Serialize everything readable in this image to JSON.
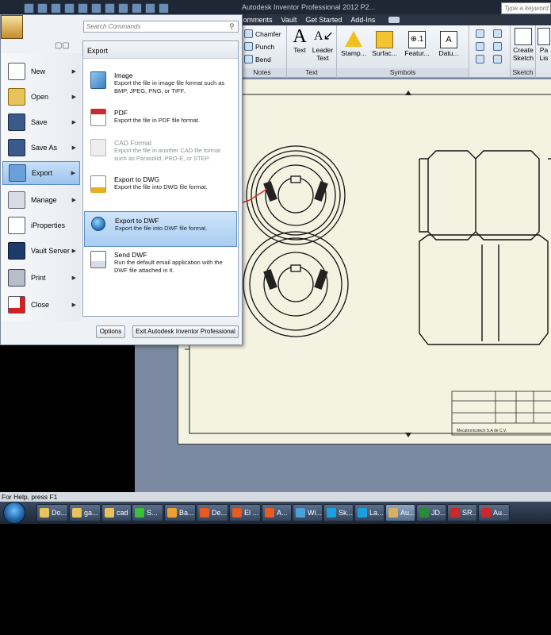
{
  "window": {
    "title": "Autodesk Inventor Professional 2012  P2..."
  },
  "keyword_search": {
    "placeholder": "Type a keyword"
  },
  "ribbon": {
    "tabs": [
      "Comments",
      "Vault",
      "Get Started",
      "Add-Ins"
    ],
    "groups": {
      "notes": {
        "label": "Notes",
        "items": [
          "Chamfer",
          "Punch",
          "Bend"
        ]
      },
      "text": {
        "label": "Text",
        "items": [
          "Text",
          "Leader Text"
        ]
      },
      "symbols": {
        "label": "Symbols",
        "items": [
          "Stamp...",
          "Surfac...",
          "Featur...",
          "Datu..."
        ]
      },
      "sketch": {
        "label": "Sketch",
        "items": [
          "Create Sketch"
        ]
      },
      "parts": {
        "items": [
          "Pa Lis"
        ]
      }
    }
  },
  "app_menu": {
    "search_placeholder": "Search Commands",
    "left_items": [
      {
        "label": "New",
        "icon": "new-document-icon",
        "has_submenu": true
      },
      {
        "label": "Open",
        "icon": "open-folder-icon",
        "has_submenu": true
      },
      {
        "label": "Save",
        "icon": "save-disk-icon",
        "has_submenu": true
      },
      {
        "label": "Save As",
        "icon": "save-as-icon",
        "has_submenu": true
      },
      {
        "label": "Export",
        "icon": "export-icon",
        "has_submenu": true,
        "selected": true
      },
      {
        "label": "Manage",
        "icon": "manage-icon",
        "has_submenu": true
      },
      {
        "label": "iProperties",
        "icon": "iproperties-icon",
        "has_submenu": false
      },
      {
        "label": "Vault Server",
        "icon": "vault-server-icon",
        "has_submenu": true
      },
      {
        "label": "Print",
        "icon": "printer-icon",
        "has_submenu": true
      },
      {
        "label": "Close",
        "icon": "close-document-icon",
        "has_submenu": true
      }
    ],
    "export_panel": {
      "heading": "Export",
      "items": [
        {
          "title": "Image",
          "desc": "Export the file in image file format such as BMP, JPEG, PNG, or TIFF.",
          "icon": "image-icon",
          "enabled": true
        },
        {
          "title": "PDF",
          "desc": "Export the file in PDF file format.",
          "icon": "pdf-icon",
          "enabled": true
        },
        {
          "title": "CAD Format",
          "desc": "Export the file in another CAD file format such as Parasolid, PRO-E, or STEP.",
          "icon": "cad-format-icon",
          "enabled": false
        },
        {
          "title": "Export to DWG",
          "desc": "Export the file into DWG file format.",
          "icon": "dwg-icon",
          "enabled": true
        },
        {
          "title": "Export to DWF",
          "desc": "Export the file into DWF file format.",
          "icon": "dwf-globe-icon",
          "enabled": true,
          "selected": true
        },
        {
          "title": "Send DWF",
          "desc": "Run the default email application with the DWF file attached in it.",
          "icon": "send-dwf-icon",
          "enabled": true
        }
      ]
    },
    "options_label": "Options",
    "exit_label": "Exit Autodesk Inventor Professional"
  },
  "drawing": {
    "title_block_company": "Mecatronicstech S.A de C.V."
  },
  "status": {
    "text": "For Help, press F1"
  },
  "taskbar": {
    "items": [
      {
        "label": "Do...",
        "color": "#e8c25a"
      },
      {
        "label": "ga...",
        "color": "#e8c25a"
      },
      {
        "label": "cad",
        "color": "#e8c25a"
      },
      {
        "label": "S...",
        "color": "#3bbf3b"
      },
      {
        "label": "Ba...",
        "color": "#f0a030"
      },
      {
        "label": "De...",
        "color": "#e85a20"
      },
      {
        "label": "El ...",
        "color": "#e85a20"
      },
      {
        "label": "A...",
        "color": "#e85a20"
      },
      {
        "label": "Wi...",
        "color": "#4aa0d8"
      },
      {
        "label": "Sk...",
        "color": "#1aa0e0"
      },
      {
        "label": "La...",
        "color": "#1aa0e0"
      },
      {
        "label": "Au...",
        "color": "#d8b060"
      },
      {
        "label": "JD...",
        "color": "#2a8a3a"
      },
      {
        "label": "SR...",
        "color": "#cc2a2a"
      },
      {
        "label": "Au...",
        "color": "#cc2a2a"
      }
    ]
  },
  "colors": {
    "accent_select": "#a9cdf2",
    "sheet": "#f4f3e2",
    "canvas_bg": "#7b8aa2",
    "annotation_red": "#d42020"
  }
}
